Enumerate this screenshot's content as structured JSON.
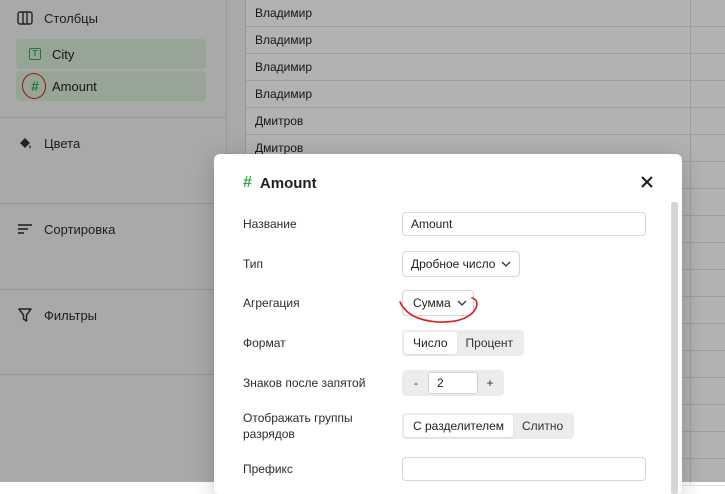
{
  "sidebar": {
    "columns_label": "Столбцы",
    "fields": [
      {
        "name": "City",
        "type_icon": "text-type-icon"
      },
      {
        "name": "Amount",
        "type_icon": "number-hash-icon"
      }
    ],
    "colors_label": "Цвета",
    "sort_label": "Сортировка",
    "filters_label": "Фильтры"
  },
  "table": {
    "rows": [
      "Владимир",
      "Владимир",
      "Владимир",
      "Владимир",
      "Дмитров",
      "Дмитров"
    ]
  },
  "dialog": {
    "title": "Amount",
    "name_label": "Название",
    "name_value": "Amount",
    "type_label": "Тип",
    "type_value": "Дробное число",
    "aggregation_label": "Агрегация",
    "aggregation_value": "Сумма",
    "format_label": "Формат",
    "format_options": [
      "Число",
      "Процент"
    ],
    "format_selected": "Число",
    "decimals_label": "Знаков после запятой",
    "decimals_minus": "-",
    "decimals_value": "2",
    "decimals_plus": "+",
    "grouping_label": "Отображать группы разрядов",
    "grouping_options": [
      "С разделителем",
      "Слитно"
    ],
    "grouping_selected": "С разделителем",
    "prefix_label": "Префикс",
    "prefix_value": ""
  },
  "colors": {
    "accent_green": "#34a853",
    "chip_bg": "#d9ecd9",
    "annotation_red": "#e21a1a"
  }
}
